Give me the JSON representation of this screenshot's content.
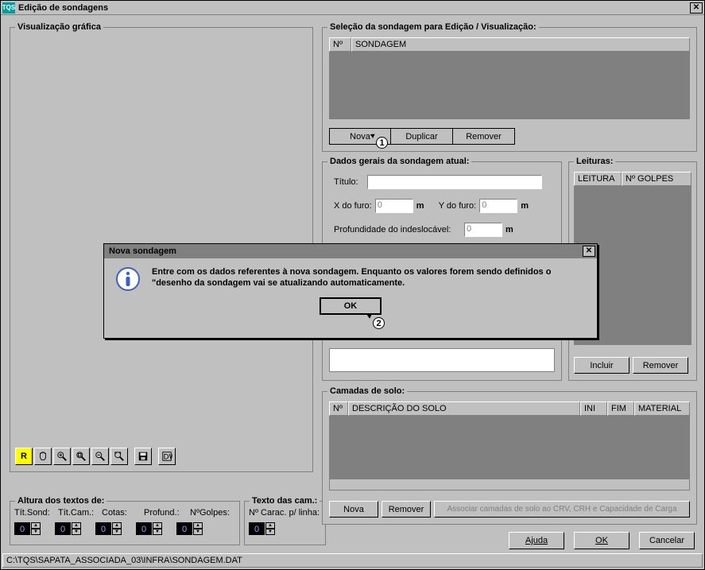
{
  "app": {
    "logo_text": "TQS",
    "title": "Edição de sondagens"
  },
  "visual": {
    "legend": "Visualização gráfica"
  },
  "altura": {
    "legend": "Altura dos textos de:",
    "col1": "Tít.Sond:",
    "col2": "Tít.Cam.:",
    "col3": "Cotas:",
    "col4": "Profund.:",
    "col5": "NºGolpes:",
    "val": "0"
  },
  "textocam": {
    "legend": "Texto das cam.:",
    "label": "Nº Carac. p/ linha:",
    "val": "0"
  },
  "selecao": {
    "legend": "Seleção da sondagem para Edição / Visualização:",
    "col_no": "Nº",
    "col_sond": "SONDAGEM",
    "btn_nova": "Nova",
    "btn_dup": "Duplicar",
    "btn_rem": "Remover"
  },
  "dados": {
    "legend": "Dados gerais da sondagem atual:",
    "titulo_label": "Título:",
    "titulo_val": "",
    "x_label": "X do furo:",
    "x_val": "0",
    "y_label": "Y do furo:",
    "y_val": "0",
    "m": "m",
    "prof_label": "Profundidade do indeslocável:",
    "prof_val": "0"
  },
  "leituras": {
    "legend": "Leituras:",
    "col1": "LEITURA",
    "col2": "Nº GOLPES",
    "btn_incluir": "Incluir",
    "btn_remover": "Remover"
  },
  "camadas": {
    "legend": "Camadas de solo:",
    "col_no": "Nº",
    "col_desc": "DESCRIÇÃO DO SOLO",
    "col_ini": "INI",
    "col_fim": "FIM",
    "col_mat": "MATERIAL",
    "btn_nova": "Nova",
    "btn_remover": "Remover",
    "btn_assoc": "Associar camadas de solo ao CRV, CRH e Capacidade de Carga"
  },
  "footer": {
    "ajuda": "Ajuda",
    "ok": "OK",
    "cancelar": "Cancelar"
  },
  "status": {
    "path": "C:\\TQS\\SAPATA_ASSOCIADA_03\\INFRA\\SONDAGEM.DAT"
  },
  "dialog": {
    "title": "Nova sondagem",
    "message": "Entre com os dados referentes à nova sondagem. Enquanto os valores forem sendo definidos o \"desenho da sondagem vai se atualizando automaticamente.",
    "ok": "OK"
  },
  "cursor": {
    "n1": "1",
    "n2": "2"
  },
  "toolbar": {
    "r_label": "R"
  }
}
